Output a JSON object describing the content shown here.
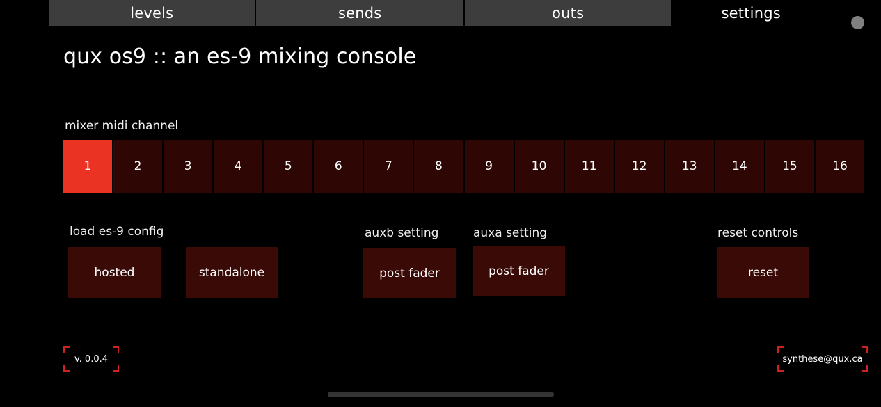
{
  "window": {
    "background_color": "#000000",
    "accent_color": "#ea3323",
    "panel_color": "#2e0604",
    "button_color": "#3a0a06",
    "tab_inactive_color": "#3d3d3d"
  },
  "tabs": [
    {
      "label": "levels",
      "active": false
    },
    {
      "label": "sends",
      "active": false
    },
    {
      "label": "outs",
      "active": false
    },
    {
      "label": "settings",
      "active": true
    }
  ],
  "status_dot": {
    "name": "status-indicator",
    "color": "#808080"
  },
  "header": {
    "title": "qux os9 :: an es-9 mixing console"
  },
  "midi": {
    "label": "mixer midi channel",
    "channels": [
      "1",
      "2",
      "3",
      "4",
      "5",
      "6",
      "7",
      "8",
      "9",
      "10",
      "11",
      "12",
      "13",
      "14",
      "15",
      "16"
    ],
    "selected": "1"
  },
  "controls": {
    "load_config": {
      "label": "load es-9 config",
      "buttons": [
        {
          "label": "hosted"
        },
        {
          "label": "standalone"
        }
      ]
    },
    "auxb": {
      "label": "auxb setting",
      "value": "post fader"
    },
    "auxa": {
      "label": "auxa setting",
      "value": "post fader"
    },
    "reset": {
      "label": "reset controls",
      "button": "reset"
    }
  },
  "footer": {
    "version": "v. 0.0.4",
    "contact": "synthese@qux.ca",
    "bracket_color": "#cc2222"
  },
  "scrollbar": {
    "name": "horizontal-scroll-handle"
  }
}
